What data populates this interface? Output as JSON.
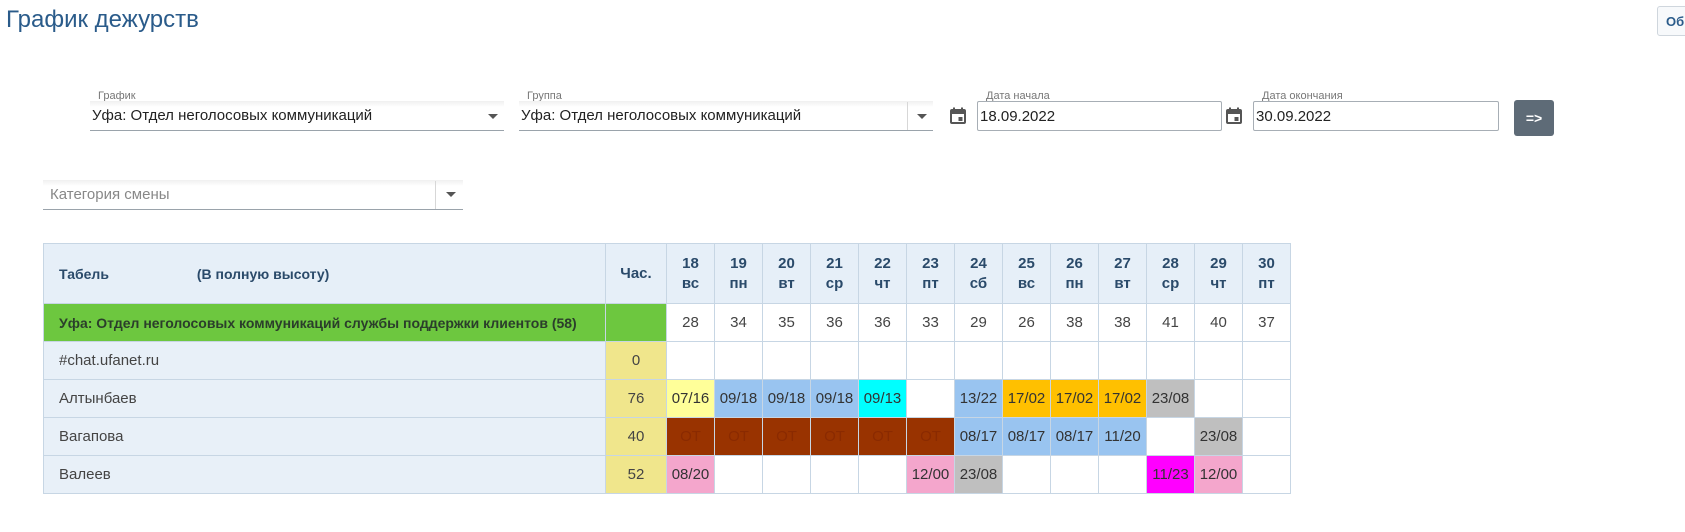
{
  "page": {
    "title": "График дежурств",
    "top_button_label": "Об"
  },
  "filters": {
    "schedule": {
      "label": "График",
      "value": "Уфа: Отдел неголосовых коммуникаций"
    },
    "group": {
      "label": "Группа",
      "value": "Уфа: Отдел неголосовых коммуникаций"
    },
    "date_start": {
      "label": "Дата начала",
      "value": "18.09.2022"
    },
    "date_end": {
      "label": "Дата окончания",
      "value": "30.09.2022"
    },
    "go_button": "=>",
    "category": {
      "placeholder": "Категория смены"
    }
  },
  "table": {
    "header": {
      "name": "Табель",
      "note": "(В полную высоту)",
      "hours": "Час."
    },
    "days": [
      {
        "num": "18",
        "wd": "вс"
      },
      {
        "num": "19",
        "wd": "пн"
      },
      {
        "num": "20",
        "wd": "вт"
      },
      {
        "num": "21",
        "wd": "ср"
      },
      {
        "num": "22",
        "wd": "чт"
      },
      {
        "num": "23",
        "wd": "пт"
      },
      {
        "num": "24",
        "wd": "сб"
      },
      {
        "num": "25",
        "wd": "вс"
      },
      {
        "num": "26",
        "wd": "пн"
      },
      {
        "num": "27",
        "wd": "вт"
      },
      {
        "num": "28",
        "wd": "ср"
      },
      {
        "num": "29",
        "wd": "чт"
      },
      {
        "num": "30",
        "wd": "пт"
      }
    ],
    "group_row": {
      "name": "Уфа: Отдел неголосовых коммуникаций службы поддержки клиентов (58)",
      "counts": [
        "28",
        "34",
        "35",
        "36",
        "36",
        "33",
        "29",
        "26",
        "38",
        "38",
        "41",
        "40",
        "37"
      ]
    },
    "rows": [
      {
        "name": "#chat.ufanet.ru",
        "hours": "0",
        "cells": [
          {
            "t": "",
            "c": ""
          },
          {
            "t": "",
            "c": ""
          },
          {
            "t": "",
            "c": ""
          },
          {
            "t": "",
            "c": ""
          },
          {
            "t": "",
            "c": ""
          },
          {
            "t": "",
            "c": ""
          },
          {
            "t": "",
            "c": ""
          },
          {
            "t": "",
            "c": ""
          },
          {
            "t": "",
            "c": ""
          },
          {
            "t": "",
            "c": ""
          },
          {
            "t": "",
            "c": ""
          },
          {
            "t": "",
            "c": ""
          },
          {
            "t": "",
            "c": ""
          }
        ]
      },
      {
        "name": "Алтынбаев",
        "hours": "76",
        "cells": [
          {
            "t": "07/16",
            "c": "#ffff99"
          },
          {
            "t": "09/18",
            "c": "#99c4f0"
          },
          {
            "t": "09/18",
            "c": "#99c4f0"
          },
          {
            "t": "09/18",
            "c": "#99c4f0"
          },
          {
            "t": "09/13",
            "c": "#00ffff"
          },
          {
            "t": "",
            "c": ""
          },
          {
            "t": "13/22",
            "c": "#99c4f0"
          },
          {
            "t": "17/02",
            "c": "#ffc000"
          },
          {
            "t": "17/02",
            "c": "#ffc000"
          },
          {
            "t": "17/02",
            "c": "#ffc000"
          },
          {
            "t": "23/08",
            "c": "#bfbfbf"
          },
          {
            "t": "",
            "c": ""
          },
          {
            "t": "",
            "c": ""
          }
        ]
      },
      {
        "name": "Вагапова",
        "hours": "40",
        "cells": [
          {
            "t": "ОТ",
            "c": "#993300"
          },
          {
            "t": "ОТ",
            "c": "#993300"
          },
          {
            "t": "ОТ",
            "c": "#993300"
          },
          {
            "t": "ОТ",
            "c": "#993300"
          },
          {
            "t": "ОТ",
            "c": "#993300"
          },
          {
            "t": "ОТ",
            "c": "#993300"
          },
          {
            "t": "08/17",
            "c": "#99c4f0"
          },
          {
            "t": "08/17",
            "c": "#99c4f0"
          },
          {
            "t": "08/17",
            "c": "#99c4f0"
          },
          {
            "t": "11/20",
            "c": "#99c4f0"
          },
          {
            "t": "",
            "c": ""
          },
          {
            "t": "23/08",
            "c": "#bfbfbf"
          },
          {
            "t": "",
            "c": ""
          }
        ]
      },
      {
        "name": "Валеев",
        "hours": "52",
        "cells": [
          {
            "t": "08/20",
            "c": "#f4a6cc"
          },
          {
            "t": "",
            "c": ""
          },
          {
            "t": "",
            "c": ""
          },
          {
            "t": "",
            "c": ""
          },
          {
            "t": "",
            "c": ""
          },
          {
            "t": "12/00",
            "c": "#f4a6cc"
          },
          {
            "t": "23/08",
            "c": "#bfbfbf"
          },
          {
            "t": "",
            "c": ""
          },
          {
            "t": "",
            "c": ""
          },
          {
            "t": "",
            "c": ""
          },
          {
            "t": "11/23",
            "c": "#ff00ff"
          },
          {
            "t": "12/00",
            "c": "#f4a6cc"
          },
          {
            "t": "",
            "c": ""
          }
        ]
      }
    ]
  }
}
